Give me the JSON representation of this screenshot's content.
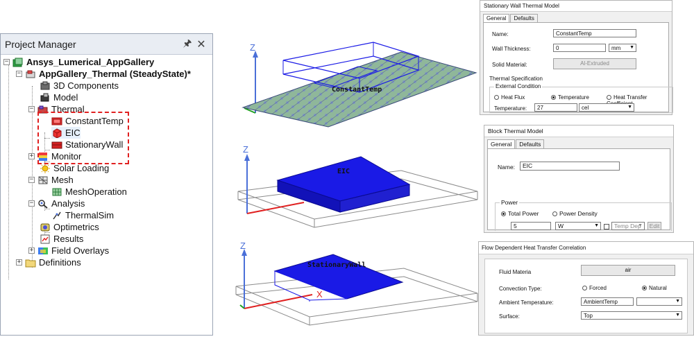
{
  "project_manager": {
    "title": "Project Manager",
    "pin_icon": "pin-icon",
    "close_icon": "close-icon",
    "tree": {
      "root": "Ansys_Lumerical_AppGallery",
      "design": "AppGallery_Thermal (SteadyState)*",
      "items": {
        "components_3d": "3D Components",
        "model": "Model",
        "thermal": "Thermal",
        "constant_temp": "ConstantTemp",
        "eic": "EIC",
        "stationary_wall": "StationaryWall",
        "monitor": "Monitor",
        "solar_loading": "Solar Loading",
        "mesh": "Mesh",
        "mesh_operation": "MeshOperation",
        "analysis": "Analysis",
        "thermal_sim": "ThermalSim",
        "optimetrics": "Optimetrics",
        "results": "Results",
        "field_overlays": "Field Overlays",
        "definitions": "Definitions"
      }
    }
  },
  "views": {
    "constant_temp": {
      "label": "ConstantTemp",
      "axis_z": "Z"
    },
    "eic": {
      "label": "EIC",
      "axis_z": "Z"
    },
    "stationary_wall": {
      "label": "StationaryWall",
      "axis_z": "Z",
      "axis_x": "X"
    }
  },
  "dialogs": {
    "stationary_wall": {
      "title": "Stationary Wall Thermal Model",
      "tab_general": "General",
      "tab_defaults": "Defaults",
      "name_label": "Name:",
      "name_value": "ConstantTemp",
      "wall_thickness_label": "Wall Thickness:",
      "wall_thickness_value": "0",
      "wall_thickness_unit": "mm",
      "solid_material_label": "Solid Material:",
      "solid_material_value": "Al-Extruded",
      "thermal_spec_label": "Thermal Specification",
      "external_condition_label": "External Condition",
      "heat_flux": "Heat Flux",
      "temperature": "Temperature",
      "heat_transfer_coeff": "Heat Transfer Coefficient",
      "temperature_label": "Temperature:",
      "temperature_value": "27",
      "temperature_unit": "cel"
    },
    "block": {
      "title": "Block Thermal Model",
      "tab_general": "General",
      "tab_defaults": "Defaults",
      "name_label": "Name:",
      "name_value": "EIC",
      "power_label": "Power",
      "total_power": "Total Power",
      "power_density": "Power Density",
      "power_value": "5",
      "power_unit": "W",
      "temp_dep": "Temp Dep",
      "edit": "Edit"
    },
    "flow": {
      "title": "Flow Dependent Heat Transfer Correlation",
      "fluid_label": "Fluid Materia",
      "fluid_value": "air",
      "convection_label": "Convection Type:",
      "forced": "Forced",
      "natural": "Natural",
      "ambient_label": "Ambient Temperature:",
      "ambient_value": "AmbientTemp",
      "surface_label": "Surface:",
      "surface_value": "Top"
    }
  },
  "colors": {
    "accent_blue": "#1a1ae6",
    "plate_green": "#8fb79a",
    "axis_red": "#e02020",
    "axis_green": "#20a020",
    "axis_blue": "#4a6fd8"
  }
}
